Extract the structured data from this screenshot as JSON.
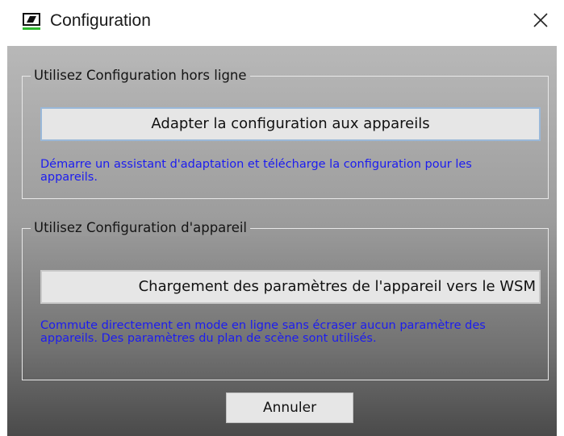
{
  "window": {
    "title": "Configuration",
    "close_icon": "close-icon",
    "app_icon": "sennheiser-logo-icon"
  },
  "offline_group": {
    "title": "Utilisez Configuration hors ligne",
    "button_label": "Adapter la configuration aux appareils",
    "description": "Démarre un assistant d'adaptation et télécharge la configuration pour les appareils."
  },
  "device_group": {
    "title": "Utilisez Configuration d'appareil",
    "button_label": "Chargement des paramètres de l'appareil vers le WSM",
    "description": "Commute directement en mode en ligne sans écraser aucun paramètre des appareils. Des paramètres du plan de scène sont utilisés."
  },
  "footer": {
    "cancel_label": "Annuler"
  },
  "colors": {
    "description_text": "#1c1cf0",
    "logo_green": "#2eb82e"
  }
}
